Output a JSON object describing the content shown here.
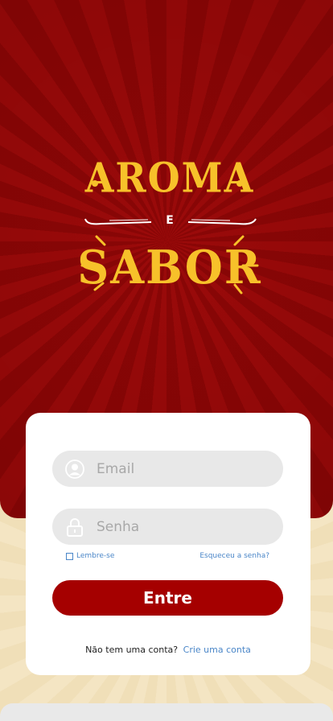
{
  "logo": {
    "top_word": "AROMA",
    "middle_word": "E",
    "bottom_word": "SABOR"
  },
  "form": {
    "email_placeholder": "Email",
    "password_placeholder": "Senha",
    "remember_label": "Lembre-se",
    "forgot_label": "Esqueceu a senha?",
    "submit_label": "Entre",
    "signup_prompt": "Não tem uma conta?",
    "signup_link": "Crie uma conta"
  },
  "colors": {
    "hero_red": "#9b0a0a",
    "logo_yellow": "#f7c12a",
    "button_red": "#a50000",
    "link_blue": "#4a86c8",
    "background_cream": "#f3e6c6"
  },
  "icons": {
    "email": "user-circle-icon",
    "password": "lock-icon"
  }
}
